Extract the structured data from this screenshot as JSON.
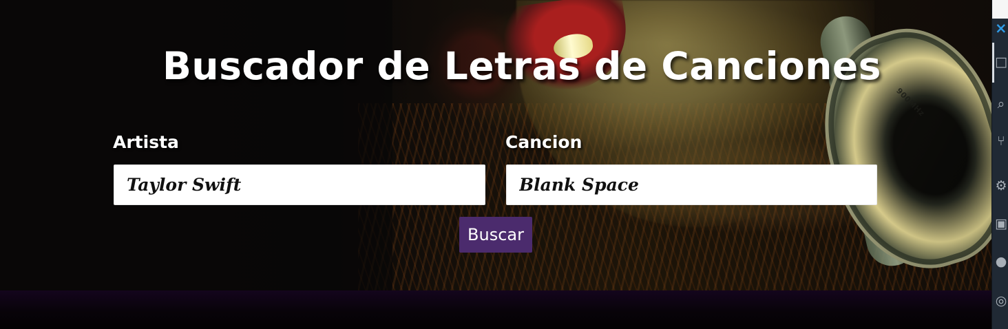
{
  "header": {
    "title": "Buscador de Letras de Canciones"
  },
  "form": {
    "artist_label": "Artista",
    "artist_value": "Taylor Swift",
    "song_label": "Cancion",
    "song_value": "Blank Space",
    "search_button_label": "Buscar"
  },
  "hero_image": {
    "headphone_text": "900MHz"
  },
  "side_panel": {
    "close_icon": "×",
    "icons": [
      {
        "name": "files-icon",
        "glyph": "□"
      },
      {
        "name": "search-icon",
        "glyph": "⌕"
      },
      {
        "name": "source-control-icon",
        "glyph": "⑂"
      },
      {
        "name": "debug-icon",
        "glyph": "⚙"
      },
      {
        "name": "extensions-icon",
        "glyph": "▣"
      },
      {
        "name": "python-icon",
        "glyph": "●"
      },
      {
        "name": "accounts-icon",
        "glyph": "◎"
      }
    ]
  },
  "colors": {
    "button_purple": "#4b2b6d",
    "side_panel": "#202934",
    "accent_blue": "#2f9be7"
  }
}
